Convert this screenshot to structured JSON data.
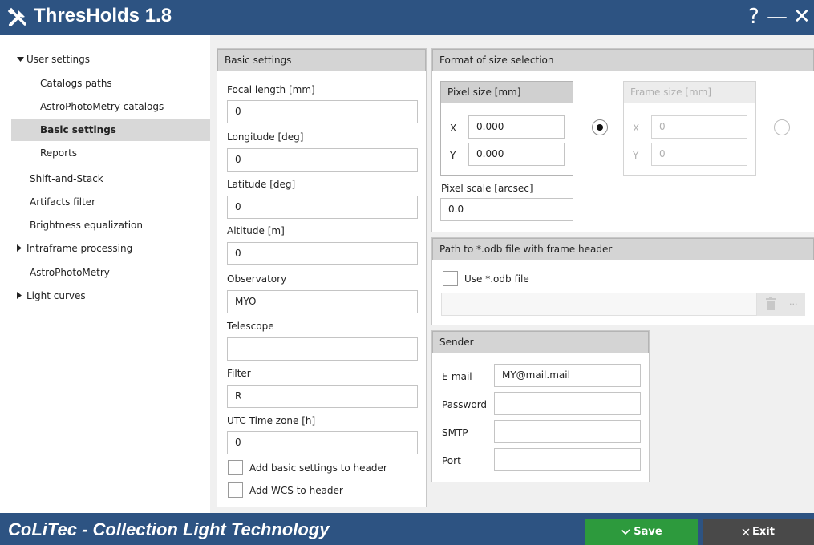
{
  "window": {
    "title": "ThresHolds 1.8",
    "help": "?",
    "minimize": "—",
    "close": "✕"
  },
  "sidebar": {
    "items": [
      {
        "label": "User settings",
        "chevron": "v"
      },
      {
        "label": "Catalogs paths"
      },
      {
        "label": "AstroPhotoMetry catalogs"
      },
      {
        "label": "Basic settings",
        "selected": true
      },
      {
        "label": "Reports"
      },
      {
        "label": "Shift-and-Stack"
      },
      {
        "label": "Artifacts filter"
      },
      {
        "label": "Brightness equalization"
      },
      {
        "label": "Intraframe processing",
        "chevron": ">"
      },
      {
        "label": "AstroPhotoMetry"
      },
      {
        "label": "Light curves",
        "chevron": ">"
      }
    ]
  },
  "basic": {
    "header": "Basic settings",
    "focal_label": "Focal length [mm]",
    "focal_value": "0",
    "longitude_label": "Longitude [deg]",
    "longitude_value": "0",
    "latitude_label": "Latitude [deg]",
    "latitude_value": "0",
    "altitude_label": "Altitude [m]",
    "altitude_value": "0",
    "observatory_label": "Observatory",
    "observatory_value": "MYO",
    "telescope_label": "Telescope",
    "telescope_value": "",
    "filter_label": "Filter",
    "filter_value": "R",
    "utc_label": "UTC Time zone [h]",
    "utc_value": "0",
    "add_header_label": "Add basic settings to header",
    "add_wcs_label": "Add WCS to header"
  },
  "format": {
    "header": "Format of size selection",
    "pixel_size_header": "Pixel size [mm]",
    "pixel_x_label": "X",
    "pixel_x_value": "0.000",
    "pixel_y_label": "Y",
    "pixel_y_value": "0.000",
    "pixel_selected": true,
    "frame_size_header": "Frame size [mm]",
    "frame_x_label": "X",
    "frame_x_value": "0",
    "frame_y_label": "Y",
    "frame_y_value": "0",
    "pixel_scale_label": "Pixel scale [arcsec]",
    "pixel_scale_value": "0.0"
  },
  "odb": {
    "header": "Path to *.odb file with frame header",
    "use_label": "Use *.odb file",
    "path_value": "",
    "browse_label": "..."
  },
  "sender": {
    "header": "Sender",
    "email_label": "E-mail",
    "email_value": "MY@mail.mail",
    "password_label": "Password",
    "password_value": "",
    "smtp_label": "SMTP",
    "smtp_value": "",
    "port_label": "Port",
    "port_value": ""
  },
  "footer": {
    "brand": "CoLiTec - Collection Light Technology",
    "save_label": "Save",
    "exit_label": "Exit"
  },
  "colors": {
    "accent": "#2d5382",
    "save": "#2d9a3d",
    "exit": "#494949",
    "selection": "#d8d8d8"
  },
  "icons": {
    "app": "tools-icon",
    "save": "chevron-down-icon",
    "exit": "close-icon",
    "delete": "trash-icon"
  }
}
